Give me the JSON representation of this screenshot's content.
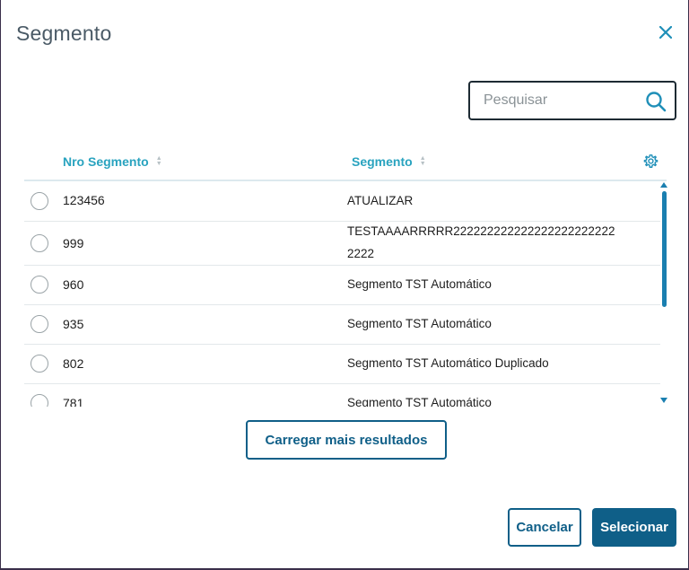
{
  "dialog": {
    "title": "Segmento",
    "close_icon": "close-icon"
  },
  "search": {
    "placeholder": "Pesquisar",
    "value": "",
    "icon": "search-icon"
  },
  "table": {
    "columns": [
      {
        "label": "Nro Segmento",
        "sortable": true
      },
      {
        "label": "Segmento",
        "sortable": true
      }
    ],
    "settings_icon": "gear-icon",
    "rows": [
      {
        "nro": "123456",
        "segmento": "ATUALIZAR",
        "selected": false
      },
      {
        "nro": "999",
        "segmento": "TESTAAAARRRRR2222222222222222222222222222",
        "selected": false
      },
      {
        "nro": "960",
        "segmento": "Segmento TST Automático",
        "selected": false
      },
      {
        "nro": "935",
        "segmento": "Segmento TST Automático",
        "selected": false
      },
      {
        "nro": "802",
        "segmento": "Segmento TST Automático Duplicado",
        "selected": false
      },
      {
        "nro": "781",
        "segmento": "Segmento TST Automático",
        "selected": false
      }
    ]
  },
  "actions": {
    "load_more": "Carregar mais resultados",
    "cancel": "Cancelar",
    "select": "Selecionar"
  },
  "colors": {
    "accent": "#29a3bf",
    "primary": "#0f5f88",
    "scrollbar": "#1a7fb0",
    "title": "#4a5a66"
  }
}
